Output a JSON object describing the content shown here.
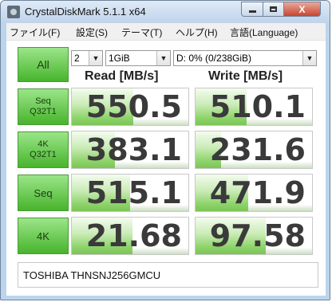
{
  "window": {
    "title": "CrystalDiskMark 5.1.1 x64",
    "close_glyph": "X"
  },
  "menu": [
    {
      "label": "ファイル(F)"
    },
    {
      "label": "設定(S)"
    },
    {
      "label": "テーマ(T)"
    },
    {
      "label": "ヘルプ(H)"
    },
    {
      "label": "言語(Language)"
    }
  ],
  "controls": {
    "all_label": "All",
    "count": "2",
    "size": "1GiB",
    "drive": "D: 0% (0/238GiB)",
    "arrow": "▼"
  },
  "headers": {
    "read": "Read [MB/s]",
    "write": "Write [MB/s]"
  },
  "rows": [
    {
      "label1": "Seq",
      "label2": "Q32T1",
      "read": "550.5",
      "read_level": 0.53,
      "write": "510.1",
      "write_level": 0.44
    },
    {
      "label1": "4K",
      "label2": "Q32T1",
      "read": "383.1",
      "read_level": 0.37,
      "write": "231.6",
      "write_level": 0.22
    },
    {
      "label1": "Seq",
      "label2": "",
      "read": "515.1",
      "read_level": 0.5,
      "write": "471.9",
      "write_level": 0.45
    },
    {
      "label1": "4K",
      "label2": "",
      "read": "21.68",
      "read_level": 0.52,
      "write": "97.58",
      "write_level": 0.6
    }
  ],
  "device_name": "TOSHIBA THNSNJ256GMCU",
  "colors": {
    "title_bg": "#bfd3ea",
    "button_green": "#47b42c",
    "bar_green": "#8ed46b",
    "close_red": "#c7452f"
  }
}
